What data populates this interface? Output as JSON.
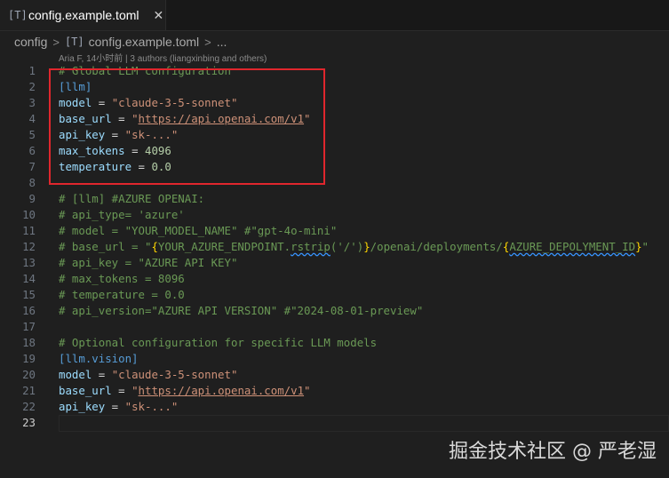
{
  "tab": {
    "icon": "[T]",
    "title": "config.example.toml",
    "close": "✕"
  },
  "breadcrumb": {
    "folder": "config",
    "sep": ">",
    "icon": "[T]",
    "file": "config.example.toml",
    "more": "..."
  },
  "blame": "Aria F, 14小时前 | 3 authors (liangxinbing and others)",
  "watermark": "掘金技术社区 @ 严老湿",
  "lines": [
    {
      "n": "1",
      "segs": [
        {
          "t": "# Global LLM configuration",
          "c": "comment"
        }
      ]
    },
    {
      "n": "2",
      "segs": [
        {
          "t": "[llm]",
          "c": "section"
        }
      ]
    },
    {
      "n": "3",
      "segs": [
        {
          "t": "model",
          "c": "key"
        },
        {
          "t": " = ",
          "c": ""
        },
        {
          "t": "\"claude-3-5-sonnet\"",
          "c": "str"
        }
      ]
    },
    {
      "n": "4",
      "segs": [
        {
          "t": "base_url",
          "c": "key"
        },
        {
          "t": " = ",
          "c": ""
        },
        {
          "t": "\"",
          "c": "str"
        },
        {
          "t": "https://api.openai.com/v1",
          "c": "url"
        },
        {
          "t": "\"",
          "c": "str"
        }
      ]
    },
    {
      "n": "5",
      "segs": [
        {
          "t": "api_key",
          "c": "key"
        },
        {
          "t": " = ",
          "c": ""
        },
        {
          "t": "\"sk-...\"",
          "c": "str"
        }
      ]
    },
    {
      "n": "6",
      "segs": [
        {
          "t": "max_tokens",
          "c": "key"
        },
        {
          "t": " = ",
          "c": ""
        },
        {
          "t": "4096",
          "c": "num"
        }
      ]
    },
    {
      "n": "7",
      "segs": [
        {
          "t": "temperature",
          "c": "key"
        },
        {
          "t": " = ",
          "c": ""
        },
        {
          "t": "0.0",
          "c": "num"
        }
      ]
    },
    {
      "n": "8",
      "segs": []
    },
    {
      "n": "9",
      "segs": [
        {
          "t": "# [llm] #AZURE OPENAI:",
          "c": "comment"
        }
      ]
    },
    {
      "n": "10",
      "segs": [
        {
          "t": "# api_type= 'azure'",
          "c": "comment"
        }
      ]
    },
    {
      "n": "11",
      "segs": [
        {
          "t": "# model = \"YOUR_MODEL_NAME\" #\"gpt-4o-mini\"",
          "c": "comment"
        }
      ]
    },
    {
      "n": "12",
      "segs": [
        {
          "t": "# base_url = \"",
          "c": "comment"
        },
        {
          "t": "{",
          "c": "brace"
        },
        {
          "t": "YOUR_AZURE_ENDPOINT.",
          "c": "comment"
        },
        {
          "t": "rstrip",
          "c": "comment squig"
        },
        {
          "t": "('/')",
          "c": "comment"
        },
        {
          "t": "}",
          "c": "brace"
        },
        {
          "t": "/openai/deployments/",
          "c": "comment"
        },
        {
          "t": "{",
          "c": "brace"
        },
        {
          "t": "AZURE_DEPOLYMENT_ID",
          "c": "comment squig"
        },
        {
          "t": "}",
          "c": "brace"
        },
        {
          "t": "\"",
          "c": "comment"
        }
      ]
    },
    {
      "n": "13",
      "segs": [
        {
          "t": "# api_key = \"AZURE API KEY\"",
          "c": "comment"
        }
      ]
    },
    {
      "n": "14",
      "segs": [
        {
          "t": "# max_tokens = 8096",
          "c": "comment"
        }
      ]
    },
    {
      "n": "15",
      "segs": [
        {
          "t": "# temperature = 0.0",
          "c": "comment"
        }
      ]
    },
    {
      "n": "16",
      "segs": [
        {
          "t": "# api_version=\"AZURE API VERSION\" #\"2024-08-01-preview\"",
          "c": "comment"
        }
      ]
    },
    {
      "n": "17",
      "segs": []
    },
    {
      "n": "18",
      "segs": [
        {
          "t": "# Optional configuration for specific LLM models",
          "c": "comment"
        }
      ]
    },
    {
      "n": "19",
      "segs": [
        {
          "t": "[llm.vision]",
          "c": "section"
        }
      ]
    },
    {
      "n": "20",
      "segs": [
        {
          "t": "model",
          "c": "key"
        },
        {
          "t": " = ",
          "c": ""
        },
        {
          "t": "\"claude-3-5-sonnet\"",
          "c": "str"
        }
      ]
    },
    {
      "n": "21",
      "segs": [
        {
          "t": "base_url",
          "c": "key"
        },
        {
          "t": " = ",
          "c": ""
        },
        {
          "t": "\"",
          "c": "str"
        },
        {
          "t": "https://api.openai.com/v1",
          "c": "url"
        },
        {
          "t": "\"",
          "c": "str"
        }
      ]
    },
    {
      "n": "22",
      "segs": [
        {
          "t": "api_key",
          "c": "key"
        },
        {
          "t": " = ",
          "c": ""
        },
        {
          "t": "\"sk-...\"",
          "c": "str"
        }
      ]
    },
    {
      "n": "23",
      "segs": [],
      "current": true
    }
  ]
}
